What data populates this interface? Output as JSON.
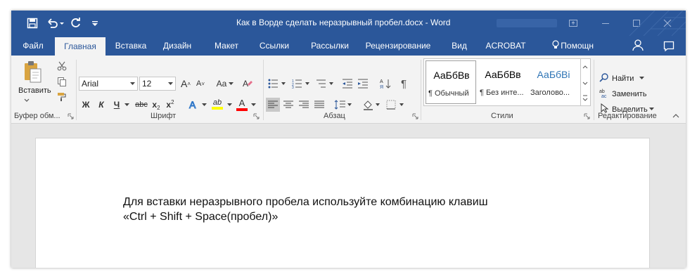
{
  "window": {
    "title": "Как в Ворде сделать неразрывный пробел.docx - Word"
  },
  "tabs": [
    {
      "label": "Файл"
    },
    {
      "label": "Главная"
    },
    {
      "label": "Вставка"
    },
    {
      "label": "Дизайн"
    },
    {
      "label": "Макет"
    },
    {
      "label": "Ссылки"
    },
    {
      "label": "Рассылки"
    },
    {
      "label": "Рецензирование"
    },
    {
      "label": "Вид"
    },
    {
      "label": "ACROBAT"
    },
    {
      "label": "Помощн"
    }
  ],
  "ribbon": {
    "clipboard": {
      "paste_label": "Вставить",
      "group_label": "Буфер обм..."
    },
    "font": {
      "font_name": "Arial",
      "font_size": "12",
      "bold": "Ж",
      "italic": "К",
      "underline": "Ч",
      "strike": "abc",
      "grow": "A",
      "shrink": "A",
      "case": "Aa",
      "highlight_letter": "ab",
      "color_letter": "A",
      "group_label": "Шрифт"
    },
    "paragraph": {
      "group_label": "Абзац"
    },
    "styles": {
      "items": [
        {
          "sample": "АаБбВв",
          "name": "¶ Обычный"
        },
        {
          "sample": "АаБбВв",
          "name": "¶ Без инте..."
        },
        {
          "sample": "АаБбВі",
          "name": "Заголово..."
        }
      ],
      "group_label": "Стили"
    },
    "editing": {
      "find_label": "Найти",
      "replace_label": "Заменить",
      "select_label": "Выделить",
      "group_label": "Редактирование"
    }
  },
  "document": {
    "lines": [
      "Для вставки неразрывного пробела используйте комбинацию клавиш",
      "«Ctrl + Shift + Space(пробел)»"
    ]
  },
  "colors": {
    "brand": "#2b579a",
    "ribbon_bg": "#f3f3f3",
    "highlight": "#ffff00",
    "font_color": "#ff0000"
  },
  "icons": [
    "save-icon",
    "undo-icon",
    "redo-icon",
    "customize-icon",
    "restore-icon",
    "minimize-icon",
    "maximize-icon",
    "close-icon",
    "person-icon",
    "comment-icon",
    "paste-icon",
    "cut-icon",
    "copy-icon",
    "format-painter-icon",
    "find-icon",
    "replace-icon",
    "select-icon",
    "lightbulb-icon"
  ]
}
